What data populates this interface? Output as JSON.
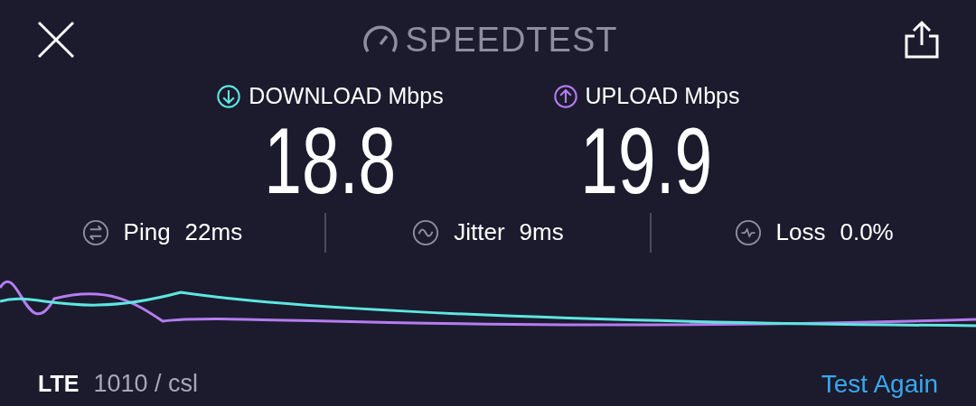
{
  "header": {
    "title": "SPEEDTEST"
  },
  "metrics": [
    {
      "kind": "download",
      "label": "DOWNLOAD Mbps",
      "value": "18.8",
      "color": "#5ee6e0"
    },
    {
      "kind": "upload",
      "label": "UPLOAD Mbps",
      "value": "19.9",
      "color": "#b57cf0"
    }
  ],
  "stats": [
    {
      "kind": "ping",
      "label": "Ping",
      "value": "22ms"
    },
    {
      "kind": "jitter",
      "label": "Jitter",
      "value": "9ms"
    },
    {
      "kind": "loss",
      "label": "Loss",
      "value": "0.0%"
    }
  ],
  "footer": {
    "network": "LTE",
    "provider": "1010 / csl",
    "action": "Test Again"
  }
}
